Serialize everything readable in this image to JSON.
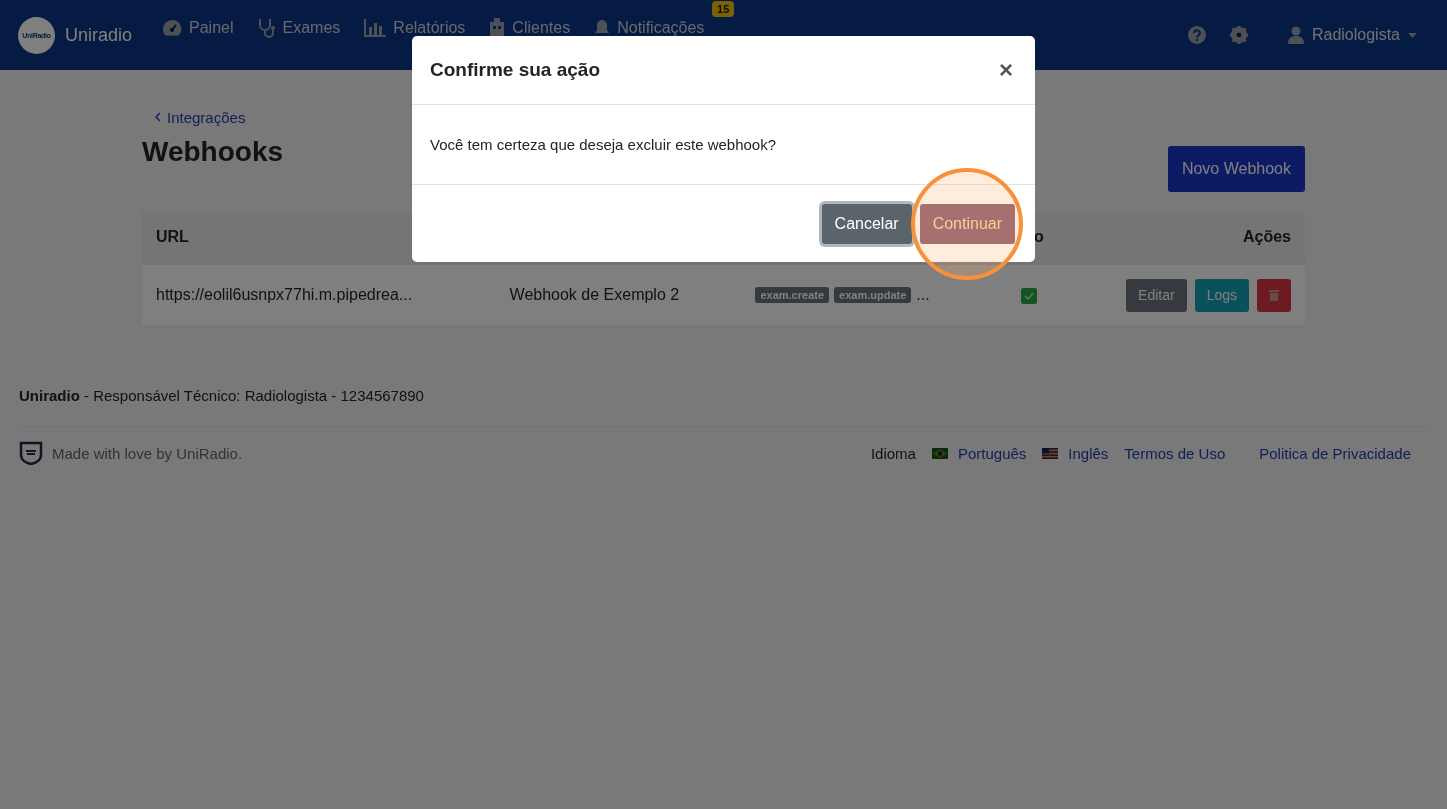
{
  "navbar": {
    "brand": "Uniradio",
    "logo_text": "UniRadio",
    "items": [
      {
        "label": "Painel"
      },
      {
        "label": "Exames"
      },
      {
        "label": "Relatórios"
      },
      {
        "label": "Clientes"
      },
      {
        "label": "Notificações",
        "badge": "15"
      }
    ],
    "user": "Radiologista"
  },
  "page": {
    "back_link": "Integrações",
    "title": "Webhooks",
    "new_button": "Novo Webhook",
    "table": {
      "columns": [
        {
          "label": "URL"
        },
        {},
        {},
        {
          "label": "o"
        },
        {
          "label": "Ações"
        }
      ],
      "rows": [
        {
          "url": "https://eolil6usnpx77hi.m.pipedrea...",
          "name": "Webhook de Exemplo 2",
          "events": [
            "exam.create",
            "exam.update"
          ],
          "events_more": "...",
          "active": true,
          "actions": [
            "Editar",
            "Logs"
          ]
        }
      ]
    }
  },
  "footer": {
    "brand": "Uniradio",
    "credit": " - Responsável Técnico: Radiologista - 1234567890",
    "made_with": "Made with love by UniRadio.",
    "language_label": "Idioma",
    "languages": [
      {
        "label": "Português"
      },
      {
        "label": "Inglês"
      }
    ],
    "links": [
      "Termos de Uso",
      "Politica de Privacidade"
    ]
  },
  "modal": {
    "title": "Confirme sua ação",
    "close": "×",
    "message": "Você tem certeza que deseja excluir este webhook?",
    "cancel": "Cancelar",
    "confirm": "Continuar",
    "highlight_confirm": true
  }
}
